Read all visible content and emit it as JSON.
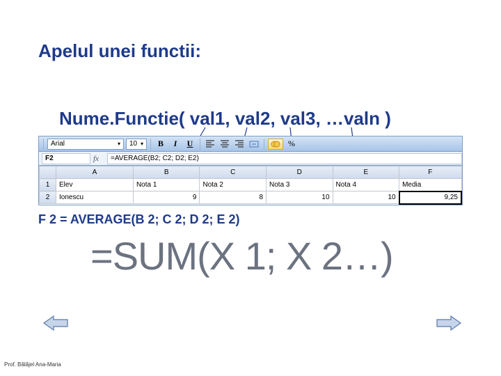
{
  "title": "Apelul unei functii:",
  "syntax": "Nume.Functie( val1, val2, val3, …valn )",
  "toolbar": {
    "font_name": "Arial",
    "font_size": "10",
    "percent": "%"
  },
  "formula_bar": {
    "cell_ref": "F2",
    "fx": "fx",
    "formula": "=AVERAGE(B2; C2; D2; E2)"
  },
  "columns": [
    "A",
    "B",
    "C",
    "D",
    "E",
    "F"
  ],
  "rows": [
    {
      "n": "1",
      "cells": [
        "Elev",
        "Nota 1",
        "Nota 2",
        "Nota 3",
        "Nota 4",
        "Media"
      ]
    },
    {
      "n": "2",
      "cells": [
        "Ionescu",
        "9",
        "8",
        "10",
        "10",
        "9,25"
      ]
    }
  ],
  "example": "F 2 = AVERAGE(B 2; C 2; D 2; E 2)",
  "big_formula": "=SUM(X 1; X 2…)",
  "footer": "Prof. Bălăjel Ana-Maria"
}
